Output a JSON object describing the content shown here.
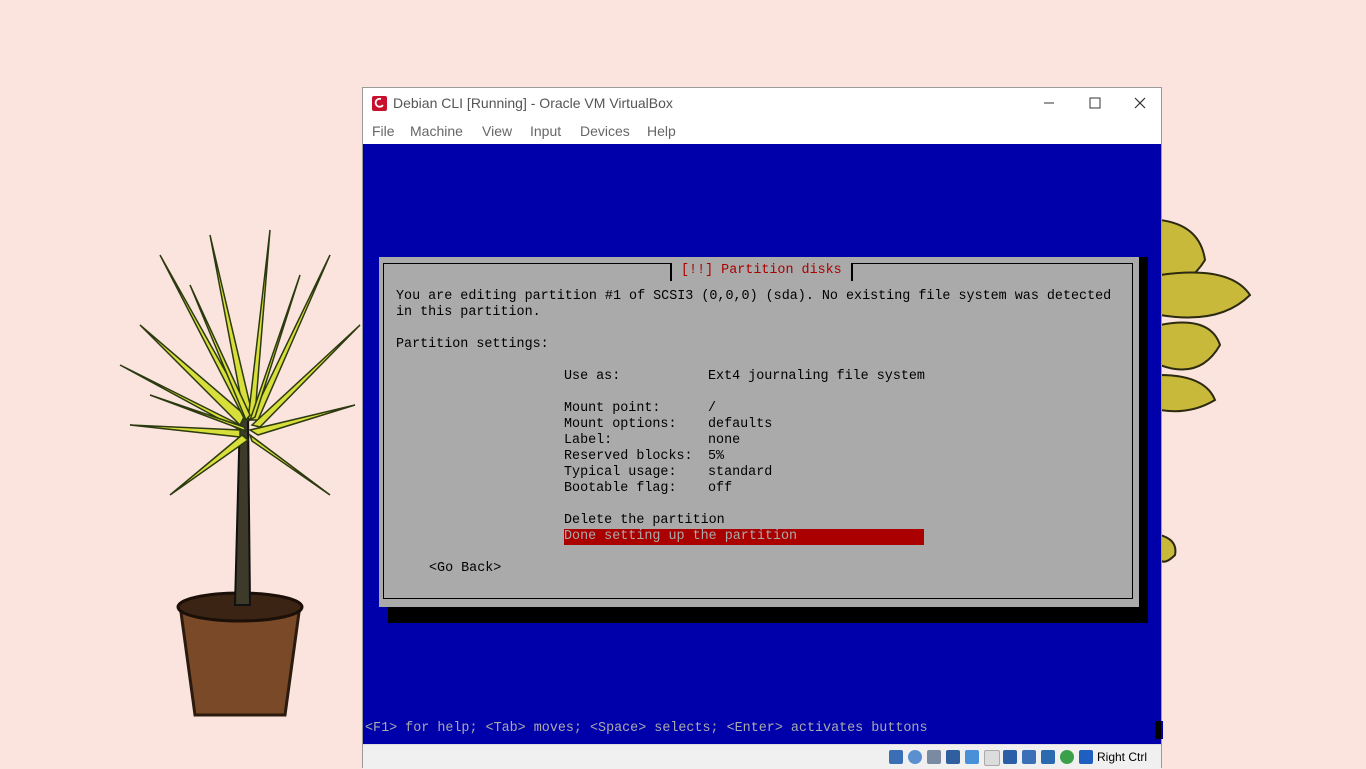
{
  "window": {
    "title": "Debian CLI [Running] - Oracle VM VirtualBox"
  },
  "menu": [
    "File",
    "Machine",
    "View",
    "Input",
    "Devices",
    "Help"
  ],
  "dialog": {
    "title": "[!!] Partition disks",
    "intro_line1": "You are editing partition #1 of SCSI3 (0,0,0) (sda). No existing file system was detected",
    "intro_line2": "in this partition.",
    "settings_heading": "Partition settings:",
    "settings": [
      {
        "label": "Use as:",
        "value": "Ext4 journaling file system"
      },
      {
        "label": "Mount point:",
        "value": "/"
      },
      {
        "label": "Mount options:",
        "value": "defaults"
      },
      {
        "label": "Label:",
        "value": "none"
      },
      {
        "label": "Reserved blocks:",
        "value": "5%"
      },
      {
        "label": "Typical usage:",
        "value": "standard"
      },
      {
        "label": "Bootable flag:",
        "value": "off"
      }
    ],
    "actions": [
      "Delete the partition",
      "Done setting up the partition"
    ],
    "go_back": "<Go Back>"
  },
  "hint_bar": "<F1> for help; <Tab> moves; <Space> selects; <Enter> activates buttons",
  "statusbar": {
    "host_key": "Right Ctrl",
    "icons": [
      "hard-disk-icon",
      "optical-drive-icon",
      "audio-icon",
      "network-icon",
      "usb-icon",
      "shared-folders-icon",
      "display-icon",
      "video-capture-icon",
      "virtualization-icon",
      "mouse-integration-icon",
      "keyboard-icon"
    ]
  },
  "colors": {
    "guest_bg": "#0000aa",
    "dialog_bg": "#aaaaaa",
    "dialog_title": "#aa0000",
    "selection": "#aa0000",
    "desktop": "#fce4de"
  }
}
